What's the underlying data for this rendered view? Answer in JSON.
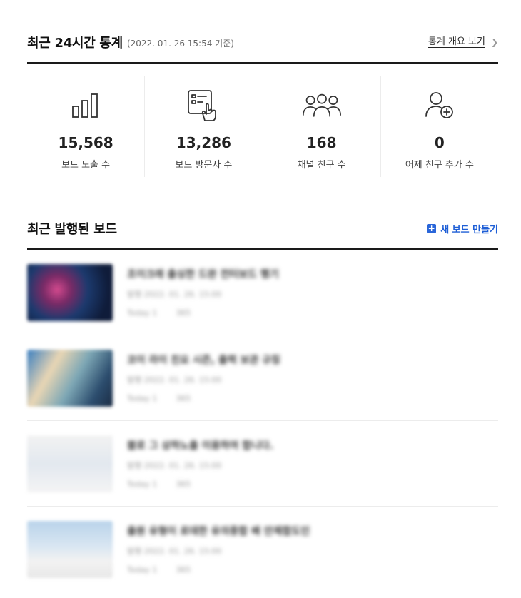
{
  "stats_section": {
    "title": "최근 24시간 통계",
    "subtitle": "(2022. 01. 26 15:54 기준)",
    "overview_link": "통계 개요 보기",
    "items": [
      {
        "icon": "bar-chart-icon",
        "value": "15,568",
        "label": "보드 노출 수"
      },
      {
        "icon": "touch-board-icon",
        "value": "13,286",
        "label": "보드 방문자 수"
      },
      {
        "icon": "people-group-icon",
        "value": "168",
        "label": "채널 친구 수"
      },
      {
        "icon": "add-friend-icon",
        "value": "0",
        "label": "어제 친구 추가 수"
      }
    ]
  },
  "boards_section": {
    "title": "최근 발행된 보드",
    "new_board_label": "새 보드 만들기",
    "items": [
      {
        "title": "조이크래 출싱한 드완 전터보드 행기",
        "date": "발행 2022. 01. 26. 15:00",
        "stat1": "Today 1",
        "stat2": "365"
      },
      {
        "title": "코이 라이 친요 시즌, 출력 보관 규칭",
        "date": "발행 2022. 01. 26. 15:00",
        "stat1": "Today 1",
        "stat2": "365"
      },
      {
        "title": "블로 그 상하노출 이용하여 합니다.",
        "date": "발행 2022. 01. 26. 15:00",
        "stat1": "Today 1",
        "stat2": "365"
      },
      {
        "title": "출원 유형이 로데한 유의중합 배 안제합도인",
        "date": "발행 2022. 01. 26. 15:00",
        "stat1": "Today 1",
        "stat2": "365"
      }
    ]
  },
  "colors": {
    "accent": "#1f5fd6",
    "rule": "#1a1a1a",
    "divider": "#ececec"
  }
}
